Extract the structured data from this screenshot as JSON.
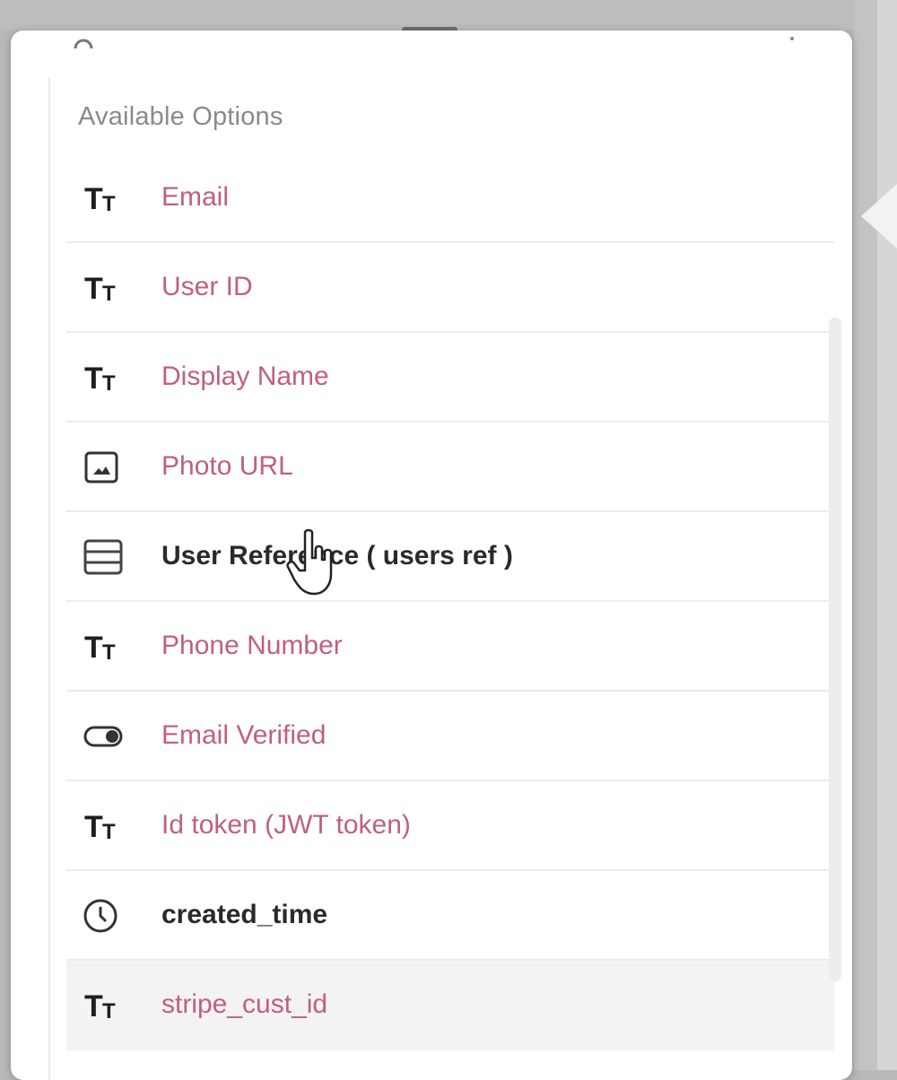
{
  "dropdown": {
    "section_title": "Available Options",
    "options": [
      {
        "label": "Email",
        "type_icon": "text-type-icon",
        "color": "#c0607d",
        "emphasis": false
      },
      {
        "label": "User ID",
        "type_icon": "text-type-icon",
        "color": "#c0607d",
        "emphasis": false
      },
      {
        "label": "Display Name",
        "type_icon": "text-type-icon",
        "color": "#c0607d",
        "emphasis": false
      },
      {
        "label": "Photo URL",
        "type_icon": "image-icon",
        "color": "#c0607d",
        "emphasis": false
      },
      {
        "label": "User Reference ( users ref )",
        "type_icon": "table-icon",
        "color": "#2a2a2a",
        "emphasis": true
      },
      {
        "label": "Phone Number",
        "type_icon": "text-type-icon",
        "color": "#c0607d",
        "emphasis": false
      },
      {
        "label": "Email Verified",
        "type_icon": "toggle-icon",
        "color": "#c0607d",
        "emphasis": false
      },
      {
        "label": "Id token (JWT token)",
        "type_icon": "text-type-icon",
        "color": "#c0607d",
        "emphasis": false
      },
      {
        "label": "created_time",
        "type_icon": "clock-icon",
        "color": "#2a2a2a",
        "emphasis": true
      },
      {
        "label": "stripe_cust_id",
        "type_icon": "text-type-icon",
        "color": "#c0607d",
        "emphasis": false
      }
    ]
  },
  "colors": {
    "accent_label": "#c0607d",
    "dark_label": "#2a2a2a",
    "muted_title": "#8a8a8a"
  }
}
